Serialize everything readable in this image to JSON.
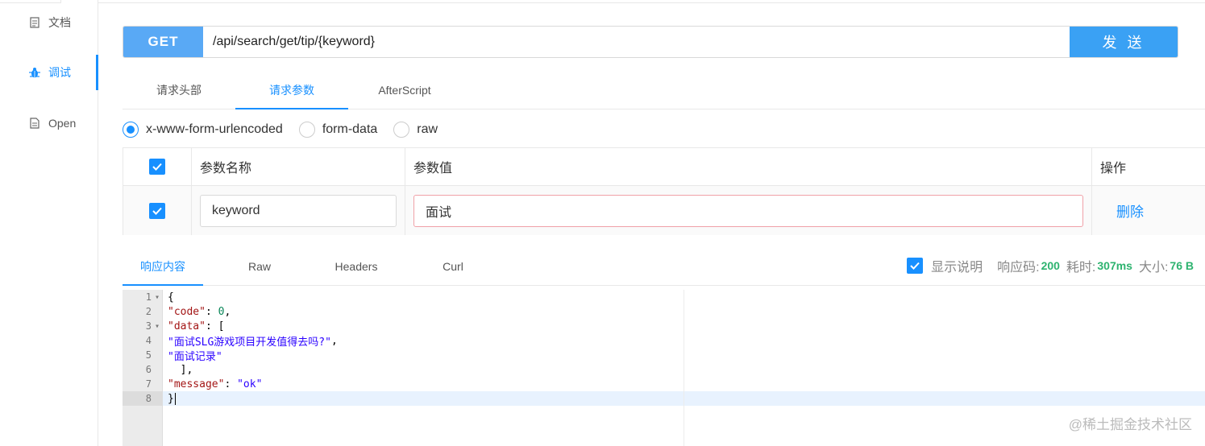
{
  "sidebar": {
    "items": [
      {
        "label": "文档",
        "icon": "document-icon"
      },
      {
        "label": "调试",
        "icon": "bug-icon"
      },
      {
        "label": "Open",
        "icon": "file-icon"
      }
    ]
  },
  "request": {
    "method": "GET",
    "url": "/api/search/get/tip/{keyword}",
    "send_label": "发 送"
  },
  "request_tabs": [
    "请求头部",
    "请求参数",
    "AfterScript"
  ],
  "body_types": [
    "x-www-form-urlencoded",
    "form-data",
    "raw"
  ],
  "params_table": {
    "headers": {
      "name": "参数名称",
      "value": "参数值",
      "action": "操作"
    },
    "rows": [
      {
        "name": "keyword",
        "value": "面试",
        "action": "删除"
      }
    ]
  },
  "response_tabs": [
    "响应内容",
    "Raw",
    "Headers",
    "Curl"
  ],
  "response_meta": {
    "show_desc_label": "显示说明",
    "status_label": "响应码:",
    "status_value": "200",
    "time_label": "耗时:",
    "time_value": "307ms",
    "size_label": "大小:",
    "size_value": "76 B"
  },
  "code": {
    "line_numbers": [
      "1",
      "2",
      "3",
      "4",
      "5",
      "6",
      "7",
      "8"
    ],
    "key_code": "\"code\"",
    "val_code": "0",
    "key_data": "\"data\"",
    "item1": "\"面试SLG游戏项目开发值得去吗?\"",
    "item2": "\"面试记录\"",
    "key_message": "\"message\"",
    "val_message": "\"ok\""
  },
  "watermark": "@稀土掘金技术社区",
  "colors": {
    "accent": "#1890ff",
    "method_bg": "#59a9f5",
    "send_bg": "#3aa1f4",
    "success": "#2db36f"
  }
}
